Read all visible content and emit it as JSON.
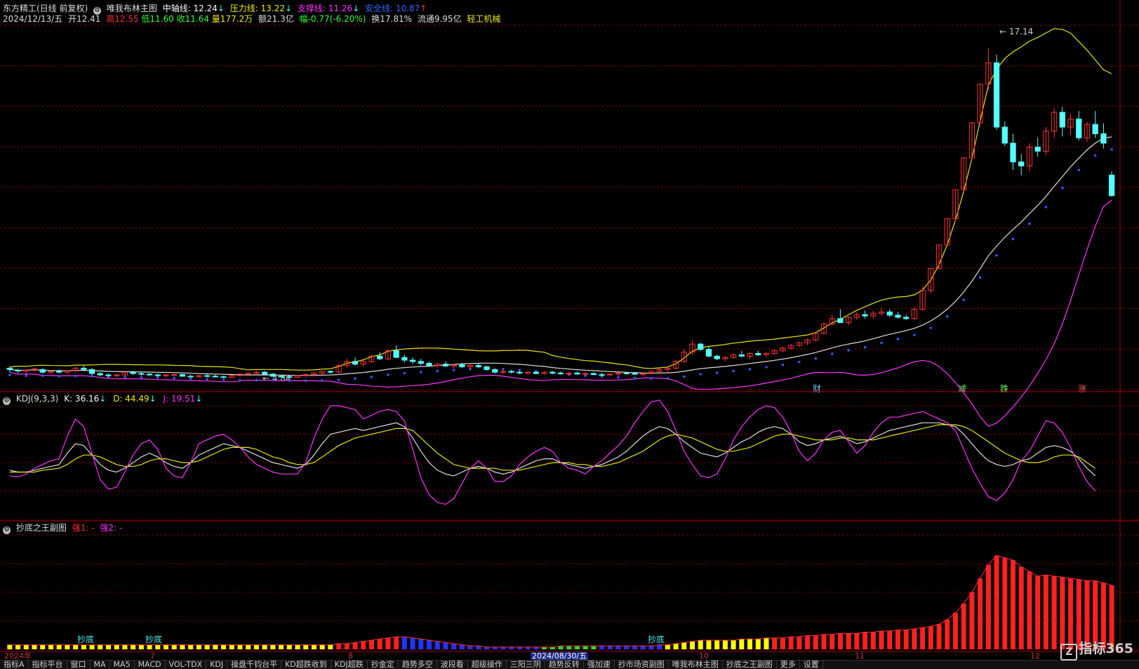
{
  "header": {
    "stock": "东方精工(日线 前复权)",
    "indicator": "唯我布林主图",
    "mid_label": "中轴线: 12.24",
    "pressure_label": "压力线: 13.22",
    "support_label": "支撑线: 11.26",
    "safe_label": "安全线: 10.87",
    "date": "2024/12/13/五",
    "open": "开12.41",
    "high": "高12.55",
    "low": "低11.60",
    "close": "收11.64",
    "volume": "量177.2万",
    "amount": "额21.3亿",
    "change": "幅-0.77(-6.20%)",
    "turnover": "换17.81%",
    "float": "流通9.95亿",
    "sector": "轻工机械"
  },
  "kdj_header": {
    "name": "KDJ(9,3,3)",
    "k": "K: 36.16",
    "d": "D: 44.49",
    "j": "J: 19.51"
  },
  "sub_header": {
    "name": "抄底之王副图",
    "s1": "强1: -",
    "s2": "强2: -"
  },
  "markers": {
    "price_high": "17.14",
    "price_low": "4.84",
    "cai": "财",
    "jian": "减",
    "die": "跌",
    "zhang": "涨",
    "chaodi": "抄底"
  },
  "date_axis": {
    "year": "2024年",
    "m7": "7",
    "m8": "8",
    "cursor": "2024/08/30/五",
    "m10": "10",
    "m11": "11",
    "m12": "12"
  },
  "tabs": [
    "指标A",
    "指标平台",
    "窗口",
    "MA",
    "MA5",
    "MACD",
    "VOL-TDX",
    "KDJ",
    "操盘千钧台平",
    "KD超跌收到",
    "KDJ超跌",
    "抄金定",
    "趋势多空",
    "波段看",
    "超级操作",
    "三阳三阴",
    "趋势反转",
    "强加速",
    "抄市场资副图",
    "唯我布林主图",
    "抄底之王副图",
    "更多",
    "设置"
  ],
  "active_tab": "2024/08/30/五",
  "logo": "指标365",
  "colors": {
    "up": "#ff3333",
    "down": "#55ffff",
    "mid": "#dddddd",
    "pressure": "#e6e600",
    "support": "#ff33ff",
    "safe": "#3355ff",
    "grid": "#7a0000"
  },
  "chart_data": {
    "type": "candlestick",
    "title": "东方精工(日线 前复权)",
    "ylim": [
      4.4,
      18.0
    ],
    "candles": [
      [
        5.2,
        5.25,
        5.05,
        5.15
      ],
      [
        5.12,
        5.18,
        5.02,
        5.1
      ],
      [
        5.1,
        5.15,
        5.0,
        5.12
      ],
      [
        5.12,
        5.2,
        5.05,
        5.18
      ],
      [
        5.15,
        5.2,
        5.0,
        5.05
      ],
      [
        5.05,
        5.1,
        4.98,
        5.08
      ],
      [
        5.08,
        5.15,
        5.0,
        5.05
      ],
      [
        5.05,
        5.12,
        4.98,
        5.1
      ],
      [
        5.1,
        5.25,
        5.05,
        5.2
      ],
      [
        5.2,
        5.3,
        5.1,
        5.15
      ],
      [
        5.15,
        5.2,
        4.95,
        5.0
      ],
      [
        5.0,
        5.05,
        4.9,
        4.95
      ],
      [
        4.95,
        5.0,
        4.88,
        4.92
      ],
      [
        4.92,
        4.98,
        4.85,
        4.95
      ],
      [
        4.95,
        5.05,
        4.9,
        5.05
      ],
      [
        5.05,
        5.1,
        4.95,
        5.0
      ],
      [
        5.0,
        5.05,
        4.92,
        4.98
      ],
      [
        4.98,
        5.02,
        4.9,
        4.95
      ],
      [
        4.95,
        5.0,
        4.88,
        4.92
      ],
      [
        4.92,
        4.98,
        4.86,
        4.95
      ],
      [
        4.95,
        5.0,
        4.9,
        4.96
      ],
      [
        4.96,
        5.0,
        4.88,
        4.9
      ],
      [
        4.9,
        4.95,
        4.84,
        4.88
      ],
      [
        4.88,
        4.95,
        4.84,
        4.92
      ],
      [
        4.92,
        4.98,
        4.86,
        4.9
      ],
      [
        4.9,
        4.96,
        4.85,
        4.88
      ],
      [
        4.88,
        4.92,
        4.84,
        4.86
      ],
      [
        4.86,
        4.95,
        4.84,
        4.93
      ],
      [
        4.93,
        5.0,
        4.88,
        4.98
      ],
      [
        4.98,
        5.05,
        4.9,
        5.0
      ],
      [
        5.0,
        5.1,
        4.95,
        5.05
      ],
      [
        5.05,
        5.1,
        4.95,
        4.98
      ],
      [
        4.98,
        5.02,
        4.88,
        4.9
      ],
      [
        4.9,
        4.95,
        4.85,
        4.88
      ],
      [
        4.88,
        4.92,
        4.84,
        4.86
      ],
      [
        4.86,
        4.95,
        4.84,
        4.92
      ],
      [
        4.92,
        5.0,
        4.88,
        4.96
      ],
      [
        4.96,
        5.05,
        4.9,
        5.02
      ],
      [
        5.02,
        5.1,
        4.95,
        5.08
      ],
      [
        5.08,
        5.12,
        5.0,
        5.05
      ],
      [
        5.05,
        5.35,
        5.0,
        5.3
      ],
      [
        5.3,
        5.55,
        5.2,
        5.45
      ],
      [
        5.45,
        5.6,
        5.3,
        5.35
      ],
      [
        5.35,
        5.5,
        5.25,
        5.45
      ],
      [
        5.45,
        5.7,
        5.4,
        5.65
      ],
      [
        5.65,
        5.8,
        5.5,
        5.55
      ],
      [
        5.55,
        5.9,
        5.5,
        5.85
      ],
      [
        5.85,
        6.05,
        5.8,
        5.6
      ],
      [
        5.6,
        5.7,
        5.4,
        5.5
      ],
      [
        5.5,
        5.6,
        5.35,
        5.45
      ],
      [
        5.45,
        5.55,
        5.3,
        5.38
      ],
      [
        5.38,
        5.45,
        5.25,
        5.3
      ],
      [
        5.3,
        5.4,
        5.2,
        5.35
      ],
      [
        5.35,
        5.45,
        5.25,
        5.28
      ],
      [
        5.28,
        5.35,
        5.2,
        5.32
      ],
      [
        5.32,
        5.4,
        5.2,
        5.25
      ],
      [
        5.25,
        5.35,
        5.15,
        5.3
      ],
      [
        5.3,
        5.38,
        5.2,
        5.25
      ],
      [
        5.25,
        5.3,
        5.1,
        5.15
      ],
      [
        5.15,
        5.2,
        5.0,
        5.05
      ],
      [
        5.05,
        5.12,
        4.98,
        5.08
      ],
      [
        5.08,
        5.15,
        5.0,
        5.05
      ],
      [
        5.05,
        5.1,
        4.98,
        5.02
      ],
      [
        5.02,
        5.08,
        4.95,
        5.05
      ],
      [
        5.05,
        5.1,
        4.98,
        5.0
      ],
      [
        5.0,
        5.08,
        4.95,
        5.05
      ],
      [
        5.05,
        5.1,
        4.98,
        5.02
      ],
      [
        5.02,
        5.08,
        4.95,
        5.0
      ],
      [
        4.98,
        5.06,
        4.93,
        5.02
      ],
      [
        5.02,
        5.08,
        4.95,
        4.98
      ],
      [
        4.98,
        5.05,
        4.92,
        5.0
      ],
      [
        5.0,
        5.05,
        4.94,
        4.96
      ],
      [
        4.96,
        5.02,
        4.9,
        4.95
      ],
      [
        4.95,
        5.0,
        4.9,
        4.98
      ],
      [
        4.98,
        5.05,
        4.92,
        5.02
      ],
      [
        5.02,
        5.05,
        4.95,
        5.0
      ],
      [
        5.0,
        5.06,
        4.94,
        4.98
      ],
      [
        4.98,
        5.05,
        4.92,
        5.0
      ],
      [
        5.0,
        5.1,
        4.96,
        5.08
      ],
      [
        5.08,
        5.2,
        5.02,
        5.15
      ],
      [
        5.15,
        5.25,
        5.05,
        5.2
      ],
      [
        5.2,
        5.5,
        5.15,
        5.45
      ],
      [
        5.45,
        5.9,
        5.4,
        5.8
      ],
      [
        5.8,
        6.25,
        5.7,
        6.1
      ],
      [
        6.1,
        6.15,
        5.85,
        5.9
      ],
      [
        5.9,
        6.0,
        5.6,
        5.65
      ],
      [
        5.65,
        5.7,
        5.5,
        5.55
      ],
      [
        5.55,
        5.65,
        5.45,
        5.6
      ],
      [
        5.6,
        5.75,
        5.55,
        5.7
      ],
      [
        5.7,
        5.85,
        5.6,
        5.65
      ],
      [
        5.65,
        5.8,
        5.55,
        5.75
      ],
      [
        5.75,
        5.85,
        5.65,
        5.7
      ],
      [
        5.7,
        5.8,
        5.6,
        5.75
      ],
      [
        5.75,
        5.9,
        5.7,
        5.85
      ],
      [
        5.85,
        6.0,
        5.8,
        5.95
      ],
      [
        5.95,
        6.1,
        5.9,
        6.05
      ],
      [
        6.05,
        6.2,
        6.0,
        6.15
      ],
      [
        6.15,
        6.3,
        6.05,
        6.25
      ],
      [
        6.25,
        6.55,
        6.2,
        6.5
      ],
      [
        6.5,
        6.9,
        6.45,
        6.85
      ],
      [
        6.85,
        7.2,
        6.8,
        7.05
      ],
      [
        7.05,
        7.4,
        6.95,
        6.9
      ],
      [
        6.9,
        7.15,
        6.8,
        7.1
      ],
      [
        7.1,
        7.3,
        7.0,
        7.2
      ],
      [
        7.2,
        7.35,
        7.05,
        7.15
      ],
      [
        7.15,
        7.35,
        7.05,
        7.25
      ],
      [
        7.25,
        7.45,
        7.15,
        7.3
      ],
      [
        7.3,
        7.4,
        7.1,
        7.18
      ],
      [
        7.18,
        7.3,
        7.05,
        7.1
      ],
      [
        7.1,
        7.2,
        7.0,
        7.05
      ],
      [
        7.05,
        7.5,
        7.0,
        7.4
      ],
      [
        7.4,
        8.25,
        7.35,
        8.1
      ],
      [
        8.1,
        8.92,
        8.0,
        8.92
      ],
      [
        8.92,
        9.8,
        8.9,
        9.8
      ],
      [
        9.8,
        10.78,
        9.75,
        10.78
      ],
      [
        10.78,
        11.86,
        10.7,
        11.86
      ],
      [
        11.86,
        13.05,
        11.8,
        13.05
      ],
      [
        13.05,
        14.36,
        13.0,
        14.36
      ],
      [
        14.36,
        15.8,
        14.3,
        15.8
      ],
      [
        15.8,
        17.14,
        15.6,
        16.6
      ],
      [
        16.6,
        16.9,
        14.1,
        14.2
      ],
      [
        14.2,
        14.4,
        13.5,
        13.6
      ],
      [
        13.6,
        13.95,
        12.6,
        12.9
      ],
      [
        12.9,
        13.2,
        12.4,
        12.75
      ],
      [
        12.75,
        13.6,
        12.55,
        13.45
      ],
      [
        13.45,
        13.8,
        13.1,
        13.3
      ],
      [
        13.3,
        14.2,
        13.15,
        14.05
      ],
      [
        14.05,
        14.9,
        13.8,
        14.75
      ],
      [
        14.75,
        14.95,
        13.85,
        14.2
      ],
      [
        14.2,
        14.7,
        13.9,
        14.5
      ],
      [
        14.5,
        14.8,
        13.7,
        13.8
      ],
      [
        13.8,
        14.4,
        13.65,
        14.3
      ],
      [
        14.3,
        14.8,
        13.8,
        13.95
      ],
      [
        13.95,
        14.35,
        13.4,
        13.6
      ],
      [
        12.41,
        12.55,
        11.6,
        11.64
      ]
    ],
    "kdj_ylim": [
      -10,
      110
    ],
    "kdj": {
      "k": [
        42,
        40,
        40,
        42,
        44,
        46,
        48,
        60,
        70,
        68,
        58,
        48,
        42,
        40,
        44,
        50,
        56,
        60,
        56,
        50,
        46,
        44,
        50,
        58,
        62,
        66,
        70,
        68,
        66,
        62,
        58,
        54,
        50,
        48,
        46,
        44,
        48,
        58,
        70,
        80,
        82,
        84,
        86,
        84,
        86,
        88,
        90,
        92,
        88,
        76,
        62,
        50,
        42,
        38,
        36,
        40,
        44,
        46,
        44,
        40,
        38,
        40,
        44,
        48,
        52,
        54,
        54,
        50,
        48,
        46,
        44,
        46,
        48,
        52,
        56,
        62,
        70,
        78,
        84,
        88,
        86,
        80,
        72,
        66,
        60,
        58,
        56,
        60,
        66,
        72,
        76,
        82,
        86,
        88,
        86,
        80,
        72,
        68,
        70,
        74,
        76,
        78,
        74,
        70,
        72,
        76,
        80,
        84,
        86,
        88,
        90,
        92,
        92,
        92,
        90,
        88,
        80,
        70,
        60,
        52,
        48,
        46,
        48,
        52,
        54,
        60,
        66,
        68,
        66,
        62,
        54,
        44,
        36
      ],
      "d": [
        40,
        40,
        40,
        40,
        42,
        43,
        44,
        48,
        54,
        58,
        58,
        56,
        52,
        48,
        46,
        46,
        48,
        52,
        54,
        54,
        52,
        50,
        50,
        52,
        56,
        60,
        64,
        66,
        66,
        66,
        64,
        60,
        56,
        54,
        50,
        48,
        48,
        50,
        56,
        62,
        68,
        72,
        76,
        78,
        80,
        82,
        84,
        86,
        86,
        84,
        76,
        68,
        60,
        54,
        48,
        46,
        44,
        44,
        44,
        44,
        42,
        42,
        42,
        44,
        46,
        48,
        50,
        50,
        50,
        48,
        48,
        46,
        46,
        48,
        50,
        54,
        58,
        62,
        68,
        74,
        78,
        80,
        78,
        76,
        72,
        68,
        64,
        62,
        62,
        64,
        66,
        70,
        74,
        78,
        80,
        80,
        78,
        76,
        74,
        74,
        74,
        76,
        76,
        74,
        74,
        74,
        76,
        78,
        80,
        82,
        84,
        86,
        88,
        90,
        90,
        90,
        88,
        84,
        78,
        72,
        66,
        60,
        56,
        52,
        50,
        50,
        52,
        56,
        58,
        58,
        56,
        50,
        44
      ],
      "j": [
        36,
        35,
        38,
        44,
        48,
        52,
        54,
        78,
        96,
        88,
        60,
        32,
        22,
        24,
        40,
        58,
        70,
        74,
        64,
        44,
        36,
        34,
        50,
        70,
        74,
        78,
        80,
        74,
        66,
        56,
        48,
        44,
        40,
        38,
        38,
        38,
        50,
        76,
        96,
        110,
        110,
        108,
        106,
        96,
        100,
        104,
        106,
        104,
        94,
        64,
        34,
        16,
        8,
        6,
        12,
        28,
        44,
        52,
        44,
        30,
        30,
        36,
        48,
        56,
        62,
        66,
        62,
        50,
        44,
        42,
        38,
        46,
        52,
        60,
        68,
        78,
        92,
        104,
        114,
        116,
        104,
        84,
        62,
        48,
        36,
        34,
        38,
        54,
        74,
        88,
        98,
        106,
        110,
        108,
        98,
        82,
        62,
        52,
        60,
        74,
        82,
        84,
        72,
        60,
        68,
        82,
        92,
        98,
        98,
        100,
        102,
        104,
        100,
        96,
        92,
        84,
        64,
        44,
        28,
        14,
        10,
        18,
        32,
        52,
        62,
        78,
        94,
        92,
        82,
        66,
        46,
        30,
        20
      ]
    },
    "sub_ylim": [
      0,
      100
    ],
    "sub": [
      4,
      4,
      4,
      4,
      4,
      4,
      4,
      4,
      4,
      4,
      4,
      4,
      4,
      4,
      4,
      4,
      4,
      4,
      4,
      4,
      4,
      4,
      4,
      4,
      4,
      4,
      4,
      4,
      4,
      4,
      4,
      4,
      4,
      4,
      4,
      4,
      4,
      4,
      4,
      4,
      5,
      5,
      6,
      7,
      8,
      9,
      10,
      11,
      11,
      10,
      9,
      8,
      7,
      6,
      5,
      4,
      3,
      3,
      2,
      2,
      2,
      2,
      2,
      2,
      2,
      2,
      2,
      3,
      3,
      3,
      3,
      3,
      3,
      3,
      3,
      3,
      3,
      3,
      3,
      4,
      4,
      5,
      6,
      7,
      8,
      8,
      8,
      8,
      8,
      9,
      9,
      9,
      10,
      10,
      10,
      11,
      11,
      12,
      12,
      13,
      13,
      14,
      14,
      14,
      15,
      15,
      16,
      16,
      17,
      17,
      18,
      19,
      20,
      22,
      26,
      32,
      40,
      50,
      62,
      74,
      82,
      80,
      78,
      72,
      68,
      64,
      65,
      64,
      63,
      62,
      61,
      60,
      60,
      58,
      56
    ],
    "sub_colors": "yyyyyyyyyyyyyyyyyyyyyyyyyyyyyyyyyyyyyyyyrrrrrrrrbbbbbbbbbbbbbbbbbgggggggbbbbbbbbyyyyyyyyyyyyyrrrrrrrrrrrrrrrrrrrrrrrrrrrrrrrrrrrrrrrrrrrbbbbbbbbbbbbbbbbbbbbbbbbbbbbbbbbbbbbbbbbbbbb"
  }
}
